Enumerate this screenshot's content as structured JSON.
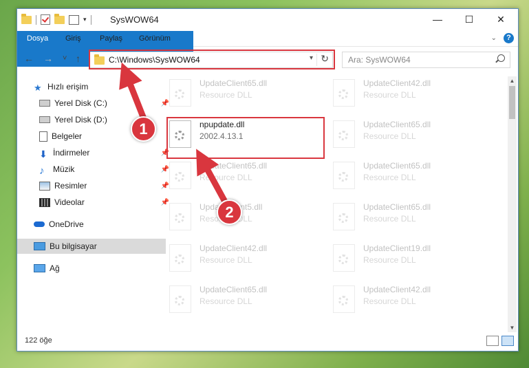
{
  "window": {
    "title": "SysWOW64",
    "controls": {
      "minimize": "—",
      "maximize": "☐",
      "close": "✕"
    }
  },
  "ribbon": {
    "tabs": [
      "Dosya",
      "Giriş",
      "Paylaş",
      "Görünüm"
    ],
    "help": "?"
  },
  "nav": {
    "back": "←",
    "forward": "→",
    "recent": "˅",
    "up": "↑",
    "address": "C:\\Windows\\SysWOW64",
    "refresh": "↻",
    "search_placeholder": "Ara: SysWOW64"
  },
  "sidebar": {
    "items": [
      {
        "label": "Hızlı erişim",
        "icon": "star-icon"
      },
      {
        "label": "Yerel Disk (C:)",
        "icon": "drive-icon"
      },
      {
        "label": "Yerel Disk (D:)",
        "icon": "drive-icon"
      },
      {
        "label": "Belgeler",
        "icon": "document-icon"
      },
      {
        "label": "İndirmeler",
        "icon": "download-icon"
      },
      {
        "label": "Müzik",
        "icon": "music-icon"
      },
      {
        "label": "Resimler",
        "icon": "pictures-icon"
      },
      {
        "label": "Videolar",
        "icon": "video-icon"
      },
      {
        "label": "OneDrive",
        "icon": "cloud-icon"
      },
      {
        "label": "Bu bilgisayar",
        "icon": "computer-icon"
      },
      {
        "label": "Ağ",
        "icon": "network-icon"
      }
    ]
  },
  "files": [
    {
      "name": "UpdateClient65.dll",
      "desc": "Resource DLL"
    },
    {
      "name": "UpdateClient42.dll",
      "desc": "Resource DLL"
    },
    {
      "name": "npupdate.dll",
      "desc": "2002.4.13.1"
    },
    {
      "name": "UpdateClient65.dll",
      "desc": "Resource DLL"
    },
    {
      "name": "UpdateClient65.dll",
      "desc": "Resource DLL"
    },
    {
      "name": "UpdateClient65.dll",
      "desc": "Resource DLL"
    },
    {
      "name": "UpdateClient5.dll",
      "desc": "Resource DLL"
    },
    {
      "name": "UpdateClient65.dll",
      "desc": "Resource DLL"
    },
    {
      "name": "UpdateClient42.dll",
      "desc": "Resource DLL"
    },
    {
      "name": "UpdateClient19.dll",
      "desc": "Resource DLL"
    },
    {
      "name": "UpdateClient65.dll",
      "desc": "Resource DLL"
    },
    {
      "name": "UpdateClient42.dll",
      "desc": "Resource DLL"
    }
  ],
  "status": {
    "count": "122 öğe"
  },
  "annotations": {
    "step1": "1",
    "step2": "2",
    "color": "#d9363e"
  }
}
